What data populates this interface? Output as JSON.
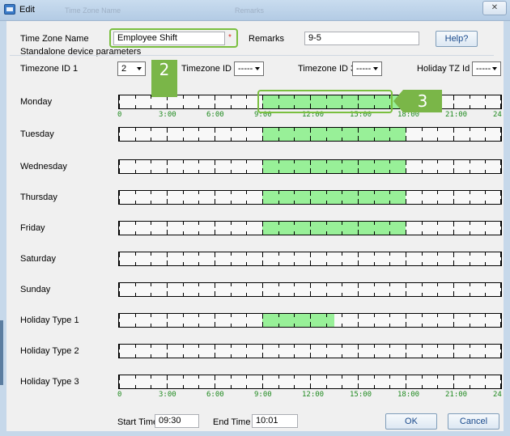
{
  "window": {
    "title": "Edit",
    "ghost_tab_1": "Time Zone Name",
    "ghost_tab_2": "Remarks",
    "close_glyph": "✕"
  },
  "form": {
    "timezone_name_label": "Time Zone Name",
    "timezone_name_value": "Employee Shift",
    "required_mark": "*",
    "remarks_label": "Remarks",
    "remarks_value": "9-5",
    "help_button": "Help?",
    "standalone_label": "Standalone device parameters",
    "tz1_label": "Timezone ID 1",
    "tz1_value": "2",
    "tz2_label": "Timezone ID 2",
    "tz2_value": "-----",
    "tz3_label": "Timezone ID 3",
    "tz3_value": "-----",
    "holiday_tz_label": "Holiday TZ Id",
    "holiday_tz_value": "-----"
  },
  "schedule": {
    "axis_labels": [
      "0",
      "3:00",
      "6:00",
      "9:00",
      "12:00",
      "15:00",
      "18:00",
      "21:00",
      "24"
    ],
    "axis_hours": [
      0,
      3,
      6,
      9,
      12,
      15,
      18,
      21,
      24
    ],
    "rows": [
      {
        "label": "Monday",
        "start": 9,
        "end": 18
      },
      {
        "label": "Tuesday",
        "start": 9,
        "end": 18
      },
      {
        "label": "Wednesday",
        "start": 9,
        "end": 18
      },
      {
        "label": "Thursday",
        "start": 9,
        "end": 18
      },
      {
        "label": "Friday",
        "start": 9,
        "end": 18
      },
      {
        "label": "Saturday",
        "start": null,
        "end": null
      },
      {
        "label": "Sunday",
        "start": null,
        "end": null
      },
      {
        "label": "Holiday Type 1",
        "start": 9,
        "end": 13.5
      },
      {
        "label": "Holiday Type 2",
        "start": null,
        "end": null
      },
      {
        "label": "Holiday Type 3",
        "start": null,
        "end": null
      }
    ]
  },
  "footer": {
    "start_time_label": "Start Time",
    "start_time_value": "09:30",
    "end_time_label": "End Time",
    "end_time_value": "10:01",
    "ok_button": "OK",
    "cancel_button": "Cancel"
  },
  "callouts": {
    "marker_2": "2",
    "marker_3": "3",
    "accent_color": "#7ab648"
  },
  "colors": {
    "active_segment": "#98f098",
    "axis_label": "#1f8a1f",
    "button_text": "#1a4a8c"
  }
}
